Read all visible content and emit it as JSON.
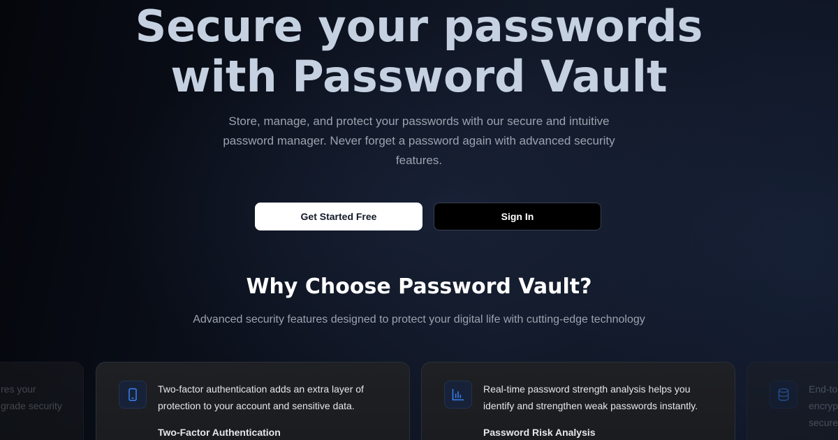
{
  "hero": {
    "title_line1": "Secure your passwords",
    "title_line2": "with Password Vault",
    "subtitle": "Store, manage, and protect your passwords with our secure and intuitive password manager. Never forget a password again with advanced security features."
  },
  "actions": {
    "primary_label": "Get Started Free",
    "secondary_label": "Sign In"
  },
  "features": {
    "title": "Why Choose Password Vault?",
    "subtitle": "Advanced security features designed to protect your digital life with cutting-edge technology",
    "cards": [
      {
        "partial_text": "res your\ngrade security",
        "icon": "shield-icon"
      },
      {
        "icon": "smartphone-icon",
        "description": "Two-factor authentication adds an extra layer of protection to your account and sensitive data.",
        "title": "Two-Factor Authentication"
      },
      {
        "icon": "bar-chart-icon",
        "description": "Real-time password strength analysis helps you identify and strengthen weak passwords instantly.",
        "title": "Password Risk Analysis"
      },
      {
        "icon": "database-icon",
        "partial_text": "End-to\nencryp\nsecure"
      }
    ]
  },
  "colors": {
    "icon_accent": "#3b82f6",
    "background": "#0b0f19"
  }
}
